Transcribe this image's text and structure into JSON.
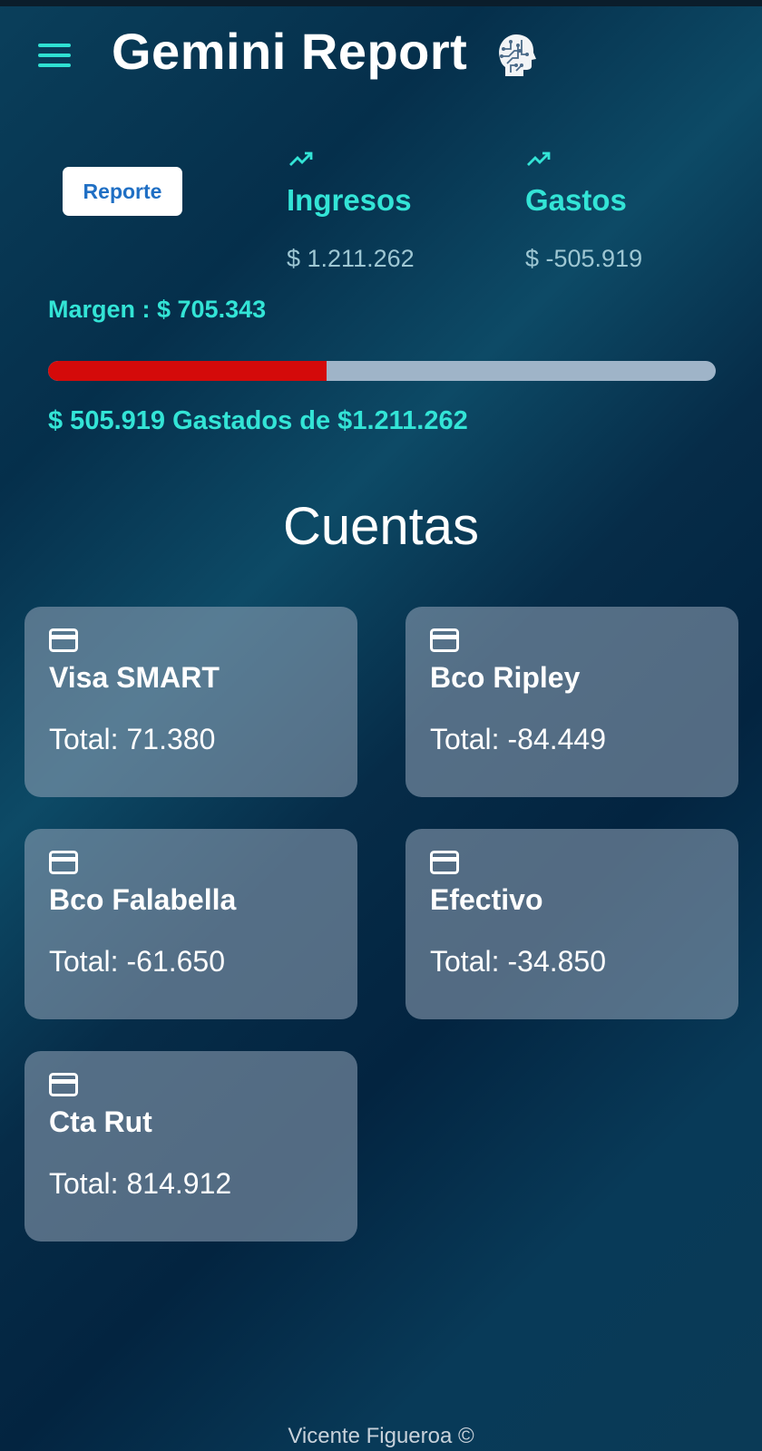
{
  "header": {
    "title": "Gemini Report",
    "menu_icon": "menu-icon",
    "logo_icon": "brain-head-logo"
  },
  "summary": {
    "report_button": "Reporte",
    "income": {
      "label": "Ingresos",
      "value": "$ 1.211.262",
      "icon": "trending-up-icon"
    },
    "expenses": {
      "label": "Gastos",
      "value": "$ -505.919",
      "icon": "trending-up-icon"
    },
    "margin": "Margen : $ 705.343",
    "spent_fraction": 0.4177,
    "spent_text": "$ 505.919 Gastados de $1.211.262",
    "colors": {
      "accent": "#33e4d6",
      "progress_fill": "#d40a0a",
      "progress_track": "#9fb4c8"
    }
  },
  "accounts": {
    "title": "Cuentas",
    "total_label": "Total:",
    "items": [
      {
        "name": "Visa SMART",
        "total": "71.380"
      },
      {
        "name": "Bco Ripley",
        "total": "-84.449"
      },
      {
        "name": "Bco Falabella",
        "total": "-61.650"
      },
      {
        "name": "Efectivo",
        "total": "-34.850"
      },
      {
        "name": "Cta Rut",
        "total": "814.912"
      }
    ]
  },
  "footer": {
    "text": "Vicente Figueroa ©"
  }
}
